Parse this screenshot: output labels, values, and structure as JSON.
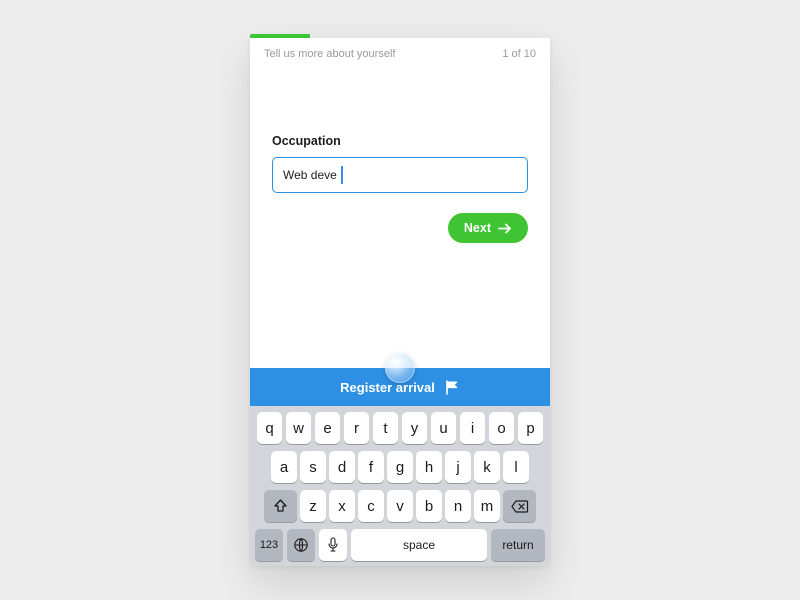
{
  "header": {
    "prompt": "Tell us more about yourself",
    "step_indicator": "1 of 10"
  },
  "progress": {
    "percent": 20
  },
  "form": {
    "label": "Occupation",
    "value": "Web deve",
    "next_label": "Next"
  },
  "banner": {
    "label": "Register arrival"
  },
  "keyboard": {
    "row1": [
      "q",
      "w",
      "e",
      "r",
      "t",
      "y",
      "u",
      "i",
      "o",
      "p"
    ],
    "row2": [
      "a",
      "s",
      "d",
      "f",
      "g",
      "h",
      "j",
      "k",
      "l"
    ],
    "row3": [
      "z",
      "x",
      "c",
      "v",
      "b",
      "n",
      "m"
    ],
    "numbers_key": "123",
    "space_key": "space",
    "return_key": "return"
  }
}
